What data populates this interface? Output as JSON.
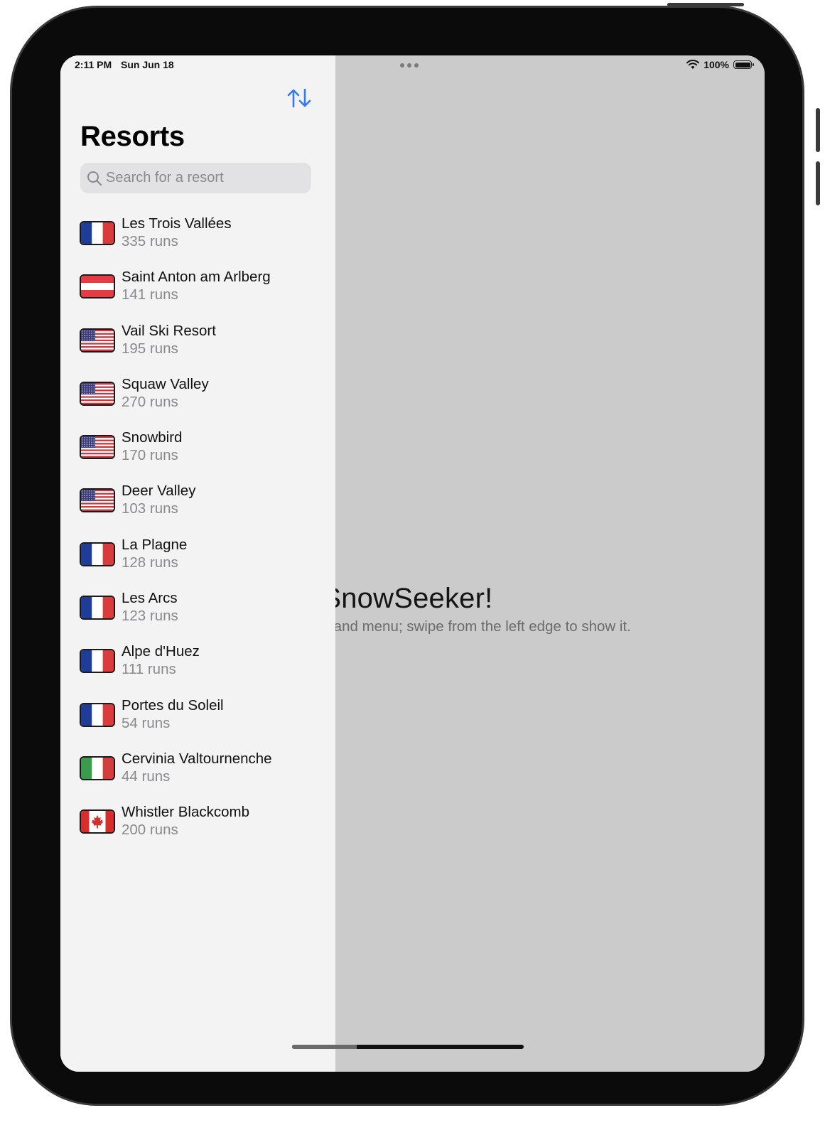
{
  "status_bar": {
    "time": "2:11 PM",
    "date": "Sun Jun 18",
    "battery": "100%"
  },
  "sidebar": {
    "title": "Resorts",
    "sort_icon": "arrow-up-down-icon",
    "search": {
      "placeholder": "Search for a resort",
      "value": ""
    },
    "resorts": [
      {
        "name": "Les Trois Vallées",
        "runs": "335 runs",
        "flag": "france-flag-icon"
      },
      {
        "name": "Saint Anton am Arlberg",
        "runs": "141 runs",
        "flag": "austria-flag-icon"
      },
      {
        "name": "Vail Ski Resort",
        "runs": "195 runs",
        "flag": "usa-flag-icon"
      },
      {
        "name": "Squaw Valley",
        "runs": "270 runs",
        "flag": "usa-flag-icon"
      },
      {
        "name": "Snowbird",
        "runs": "170 runs",
        "flag": "usa-flag-icon"
      },
      {
        "name": "Deer Valley",
        "runs": "103 runs",
        "flag": "usa-flag-icon"
      },
      {
        "name": "La Plagne",
        "runs": "128 runs",
        "flag": "france-flag-icon"
      },
      {
        "name": "Les Arcs",
        "runs": "123 runs",
        "flag": "france-flag-icon"
      },
      {
        "name": "Alpe d'Huez",
        "runs": "111 runs",
        "flag": "france-flag-icon"
      },
      {
        "name": "Portes du Soleil",
        "runs": "54 runs",
        "flag": "france-flag-icon"
      },
      {
        "name": "Cervinia Valtournenche",
        "runs": "44 runs",
        "flag": "italy-flag-icon"
      },
      {
        "name": "Whistler Blackcomb",
        "runs": "200 runs",
        "flag": "canada-flag-icon"
      }
    ]
  },
  "detail": {
    "welcome_title": "me to SnowSeeker!",
    "welcome_subtitle": "e left-hand menu; swipe from the left edge to show it."
  },
  "colors": {
    "accent": "#3478f6",
    "sidebar_bg": "#f3f3f3",
    "detail_bg": "#cbcbcb"
  }
}
